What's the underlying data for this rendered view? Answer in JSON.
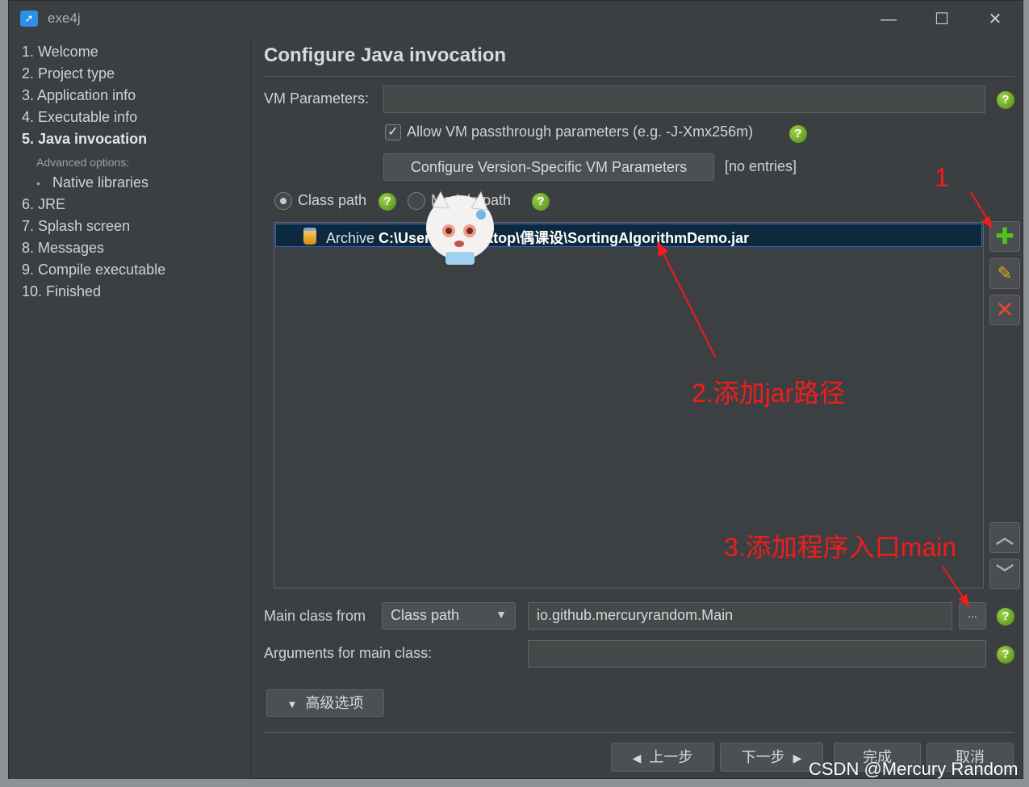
{
  "window": {
    "title": "exe4j",
    "controls": {
      "minimize": "—",
      "maximize": "☐",
      "close": "✕"
    }
  },
  "sidebar": {
    "items": [
      {
        "label": "1. Welcome"
      },
      {
        "label": "2. Project type"
      },
      {
        "label": "3. Application info"
      },
      {
        "label": "4. Executable info"
      },
      {
        "label": "5. Java invocation",
        "active": true
      },
      {
        "label": "6. JRE"
      },
      {
        "label": "7. Splash screen"
      },
      {
        "label": "8. Messages"
      },
      {
        "label": "9. Compile executable"
      },
      {
        "label": "10. Finished"
      }
    ],
    "advanced_label": "Advanced options:",
    "advanced_items": [
      {
        "label": "Native libraries"
      }
    ]
  },
  "main": {
    "title": "Configure Java invocation",
    "vm_params": {
      "label": "VM Parameters:",
      "value": ""
    },
    "passthrough": {
      "label": "Allow VM passthrough parameters (e.g. -J-Xmx256m)",
      "checked": true
    },
    "version_button": {
      "label": "Configure Version-Specific VM Parameters",
      "status": "[no entries]"
    },
    "radio": {
      "class_path": "Class path",
      "module_path": "Module path",
      "selected": "Class path"
    },
    "classpath_entries": [
      {
        "prefix": "Archive",
        "path": "C:\\Users\\...\\Desktop\\偶课设\\SortingAlgorithmDemo.jar"
      }
    ],
    "main_class": {
      "label": "Main class from",
      "source": "Class path",
      "value": "io.github.mercuryrandom.Main",
      "browse": "..."
    },
    "arguments": {
      "label": "Arguments for main class:",
      "value": ""
    },
    "advanced_button": "高级选项",
    "nav": {
      "back": "上一步",
      "next": "下一步",
      "finish": "完成",
      "cancel": "取消"
    }
  },
  "annotations": {
    "step1": "1",
    "step2": "2.添加jar路径",
    "step3": "3.添加程序入口main"
  },
  "watermark": "CSDN @Mercury Random",
  "colors": {
    "annotation": "#f21c1c",
    "help": "#5e9d1e",
    "selection": "#0d293e"
  }
}
